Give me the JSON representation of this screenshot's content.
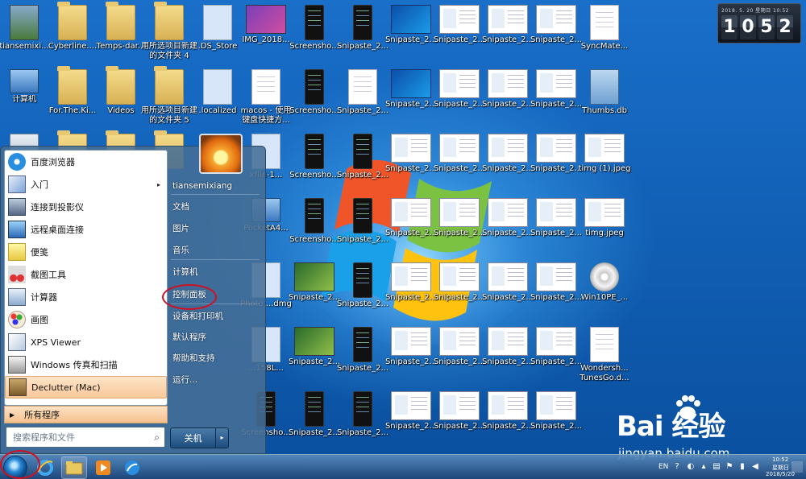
{
  "desktop_icons": [
    {
      "label": "tiansemixi...",
      "kind": "person"
    },
    {
      "label": "Cyberline....",
      "kind": "folder"
    },
    {
      "label": "Temps-dar...",
      "kind": "folder"
    },
    {
      "label": "用所选项目新建的文件夹 4",
      "kind": "folder"
    },
    {
      "label": ".DS_Store",
      "kind": "blank"
    },
    {
      "label": "IMG_2018...",
      "kind": "img"
    },
    {
      "label": "Screensho...",
      "kind": "phone"
    },
    {
      "label": "Snipaste_2...",
      "kind": "phone"
    },
    {
      "label": "Snipaste_2...",
      "kind": "win7"
    },
    {
      "label": "Snipaste_2...",
      "kind": "shot"
    },
    {
      "label": "Snipaste_2...",
      "kind": "shot"
    },
    {
      "label": "Snipaste_2...",
      "kind": "shot"
    },
    {
      "label": "SyncMate...",
      "kind": "doc"
    },
    {
      "label": "计算机",
      "kind": "comp"
    },
    {
      "label": "For.The.Ki...",
      "kind": "folder"
    },
    {
      "label": "Videos",
      "kind": "folder"
    },
    {
      "label": "用所选项目新建的文件夹 5",
      "kind": "folder"
    },
    {
      "label": ".localized",
      "kind": "blank"
    },
    {
      "label": "macos - 使用键盘快捷方...",
      "kind": "doc"
    },
    {
      "label": "Screensho...",
      "kind": "phone"
    },
    {
      "label": "Snipaste_2...",
      "kind": "doc"
    },
    {
      "label": "Snipaste_2...",
      "kind": "win7"
    },
    {
      "label": "Snipaste_2...",
      "kind": "shot"
    },
    {
      "label": "Snipaste_2...",
      "kind": "shot"
    },
    {
      "label": "Snipaste_2...",
      "kind": "shot"
    },
    {
      "label": "Thumbs.db",
      "kind": "db"
    },
    {
      "label": "",
      "kind": "recycle"
    },
    {
      "label": "",
      "kind": "folder"
    },
    {
      "label": "",
      "kind": "folder"
    },
    {
      "label": "",
      "kind": "folder"
    },
    {
      "label": "xfile-1...",
      "kind": "blank"
    },
    {
      "label": "Screensho...",
      "kind": "phone"
    },
    {
      "label": "Snipaste_2...",
      "kind": "phone"
    },
    {
      "label": "Snipaste_2...",
      "kind": "shot"
    },
    {
      "label": "Snipaste_2...",
      "kind": "shot"
    },
    {
      "label": "Snipaste_2...",
      "kind": "shot"
    },
    {
      "label": "Snipaste_2...",
      "kind": "shot"
    },
    {
      "label": "timg (1).jpeg",
      "kind": "shot"
    },
    {
      "label": "PocketA4...",
      "kind": "comp"
    },
    {
      "label": "Screensho...",
      "kind": "phone"
    },
    {
      "label": "Snipaste_2...",
      "kind": "phone"
    },
    {
      "label": "Snipaste_2...",
      "kind": "shot"
    },
    {
      "label": "Snipaste_2...",
      "kind": "shot"
    },
    {
      "label": "Snipaste_2...",
      "kind": "shot"
    },
    {
      "label": "Snipaste_2...",
      "kind": "shot"
    },
    {
      "label": "timg.jpeg",
      "kind": "shot"
    },
    {
      "label": "Photo ...dmg",
      "kind": "blank"
    },
    {
      "label": "Snipaste_2...",
      "kind": "green"
    },
    {
      "label": "Snipaste_2...",
      "kind": "phone"
    },
    {
      "label": "Snipaste_2...",
      "kind": "shot"
    },
    {
      "label": "Snipaste_2...",
      "kind": "shot"
    },
    {
      "label": "Snipaste_2...",
      "kind": "shot"
    },
    {
      "label": "Snipaste_2...",
      "kind": "shot"
    },
    {
      "label": "Win10PE_...",
      "kind": "disc"
    },
    {
      "label": "...158L...",
      "kind": "blank"
    },
    {
      "label": "Snipaste_2...",
      "kind": "green"
    },
    {
      "label": "Snipaste_2...",
      "kind": "phone"
    },
    {
      "label": "Snipaste_2...",
      "kind": "shot"
    },
    {
      "label": "Snipaste_2...",
      "kind": "shot"
    },
    {
      "label": "Snipaste_2...",
      "kind": "shot"
    },
    {
      "label": "Snipaste_2...",
      "kind": "shot"
    },
    {
      "label": "Wondersh... TunesGo.d...",
      "kind": "doc"
    },
    {
      "label": "Screensho...",
      "kind": "phone"
    },
    {
      "label": "Snipaste_2...",
      "kind": "phone"
    },
    {
      "label": "Snipaste_2...",
      "kind": "phone"
    },
    {
      "label": "Snipaste_2...",
      "kind": "shot"
    },
    {
      "label": "Snipaste_2...",
      "kind": "shot"
    },
    {
      "label": "Snipaste_2...",
      "kind": "shot"
    },
    {
      "label": "Snipaste_2...",
      "kind": "shot"
    }
  ],
  "clock": {
    "date": "2018. 5. 20   星期日   10:52",
    "digits": [
      "1",
      "0",
      "5",
      "2"
    ]
  },
  "start_menu": {
    "pinned": [
      {
        "label": "百度浏览器",
        "icon": "baidu-browser-icon"
      },
      {
        "label": "入门",
        "icon": "getting-started-icon",
        "submenu": "▸"
      },
      {
        "label": "连接到投影仪",
        "icon": "projector-icon"
      },
      {
        "label": "远程桌面连接",
        "icon": "remote-desktop-icon"
      },
      {
        "label": "便笺",
        "icon": "sticky-notes-icon"
      },
      {
        "label": "截图工具",
        "icon": "snipping-tool-icon"
      },
      {
        "label": "计算器",
        "icon": "calculator-icon"
      },
      {
        "label": "画图",
        "icon": "paint-icon"
      },
      {
        "label": "XPS Viewer",
        "icon": "xps-viewer-icon"
      },
      {
        "label": "Windows 传真和扫描",
        "icon": "fax-scan-icon"
      },
      {
        "label": "Declutter (Mac)",
        "icon": "declutter-icon"
      }
    ],
    "all_programs": "所有程序",
    "search_placeholder": "搜索程序和文件",
    "right_links": [
      "tiansemixiang",
      "文档",
      "图片",
      "音乐",
      "计算机",
      "控制面板",
      "设备和打印机",
      "默认程序",
      "帮助和支持",
      "运行..."
    ],
    "shutdown": "关机",
    "shutdown_arrow": "▸"
  },
  "taskbar": {
    "lang": "EN",
    "time": "10:52",
    "weekday": "星期日",
    "date": "2018/5/20"
  },
  "watermark": {
    "brand": "Bai 经验",
    "site": "jingyan.baidu.com"
  },
  "colors": {
    "highlight_circle": "#d01020",
    "desktop_blue": "#1160b6"
  }
}
